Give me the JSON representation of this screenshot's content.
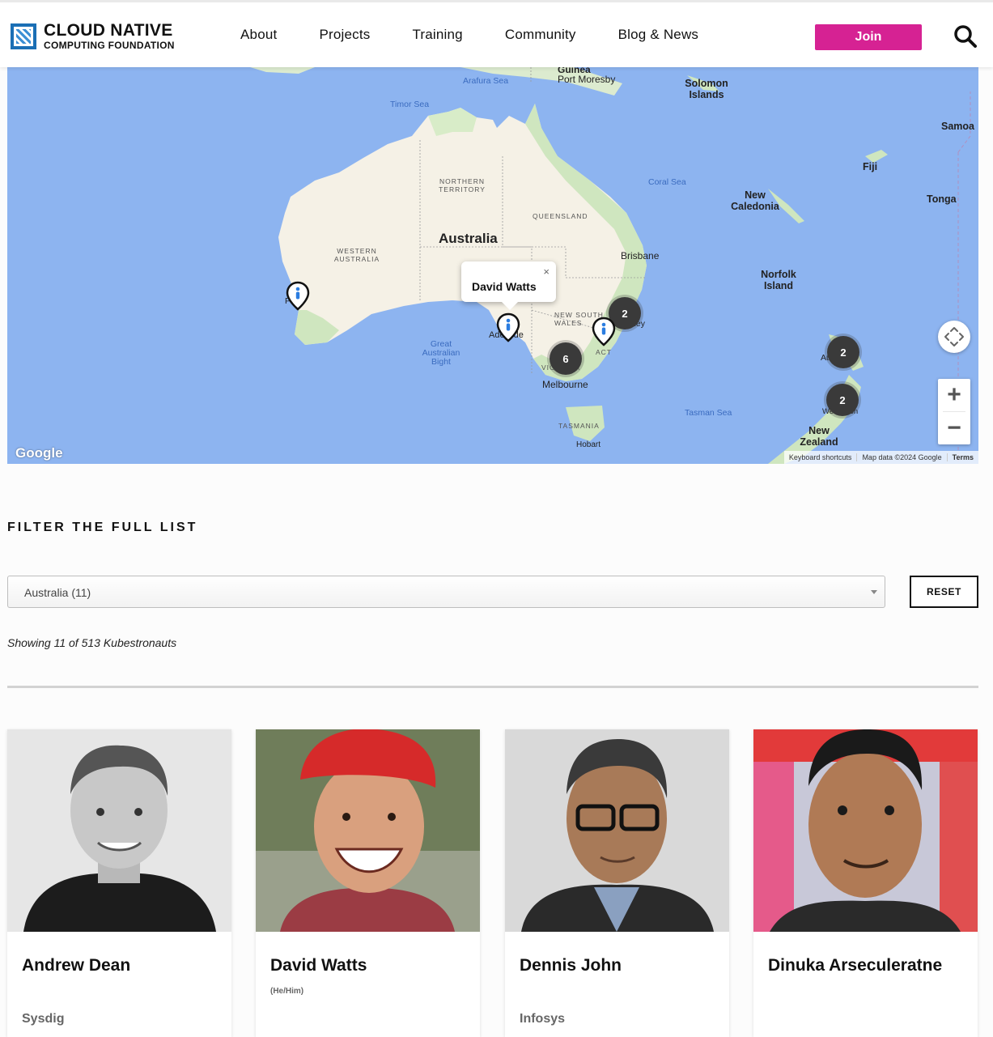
{
  "header": {
    "logo_line1": "CLOUD NATIVE",
    "logo_line2": "COMPUTING FOUNDATION",
    "nav": [
      "About",
      "Projects",
      "Training",
      "Community",
      "Blog & News"
    ],
    "join_label": "Join"
  },
  "map": {
    "labels": {
      "country": "Australia",
      "northern_territory": "NORTHERN TERRITORY",
      "queensland": "QUEENSLAND",
      "western_australia": "WESTERN AUSTRALIA",
      "new_south_wales": "NEW SOUTH WALES",
      "victoria": "VICTORIA",
      "tasmania": "TASMANIA",
      "act": "ACT",
      "arafura_sea": "Arafura Sea",
      "timor_sea": "Timor Sea",
      "coral_sea": "Coral Sea",
      "tasman_sea": "Tasman Sea",
      "great_australian_bight": "Great Australian Bight",
      "port_moresby": "Port Moresby",
      "guinea": "Guinea",
      "solomon_islands": "Solomon Islands",
      "samoa": "Samoa",
      "fiji": "Fiji",
      "tonga": "Tonga",
      "new_caledonia": "New Caledonia",
      "norfolk_island": "Norfolk Island",
      "brisbane": "Brisbane",
      "sydney": "Sydney",
      "melbourne": "Melbourne",
      "hobart": "Hobart",
      "adelaide": "Adelaide",
      "perth": "Perth",
      "auckland": "Auckland",
      "wellington": "Wellington",
      "new_zealand": "New Zealand"
    },
    "clusters": [
      "2",
      "6",
      "2",
      "2"
    ],
    "popup_name": "David Watts",
    "popup_close": "×",
    "zoom_in": "+",
    "zoom_out": "−",
    "google": "Google",
    "attribution": [
      "Keyboard shortcuts",
      "Map data ©2024 Google",
      "Terms"
    ]
  },
  "filter": {
    "title": "FILTER THE FULL LIST",
    "selected": "Australia  (11)",
    "reset_label": "RESET",
    "showing": "Showing 11 of 513 Kubestronauts"
  },
  "cards": [
    {
      "name": "Andrew Dean",
      "pronoun": "",
      "company": "Sysdig"
    },
    {
      "name": "David Watts",
      "pronoun": "(He/Him)",
      "company": ""
    },
    {
      "name": "Dennis John",
      "pronoun": "",
      "company": "Infosys"
    },
    {
      "name": "Dinuka Arseculeratne",
      "pronoun": "",
      "company": ""
    }
  ],
  "colors": {
    "join": "#d62293",
    "ocean": "#8db4f0",
    "land": "#f5f1e6",
    "vegetation": "#cfe6bf",
    "cluster": "#3a3a3a"
  }
}
